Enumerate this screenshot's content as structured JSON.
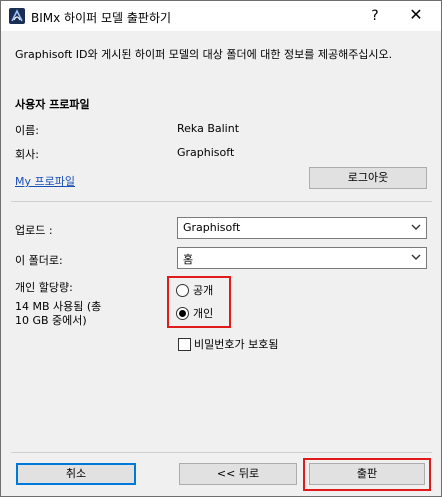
{
  "window": {
    "title": "BIMx 하이퍼 모델 출판하기",
    "help": "?",
    "close": "✕"
  },
  "intro": "Graphisoft ID와 게시된 하이퍼 모델의 대상 폴더에 대한 정보를 제공해주십시오.",
  "profile": {
    "heading": "사용자 프로파일",
    "name_label": "이름:",
    "name_value": "Reka Balint",
    "company_label": "회사:",
    "company_value": "Graphisoft",
    "my_profile_link": "My 프로파일",
    "logout_button": "로그아웃"
  },
  "upload": {
    "upload_label": "업로드 :",
    "upload_value": "Graphisoft",
    "folder_label": "이 폴더로:",
    "folder_value": "홈",
    "quota_label": "개인 할당량:",
    "quota_used": "14 MB  사용됨 (총",
    "quota_total": "10 GB 중에서)",
    "radio_public": "공개",
    "radio_private": "개인",
    "selected_privacy": "private",
    "password_checkbox": "비밀번호가 보호됨",
    "password_checked": false
  },
  "footer": {
    "cancel": "취소",
    "back": "<< 뒤로",
    "publish": "출판"
  },
  "colors": {
    "highlight": "#e01b1b",
    "link": "#1a4fb5",
    "focus": "#0078d7"
  }
}
